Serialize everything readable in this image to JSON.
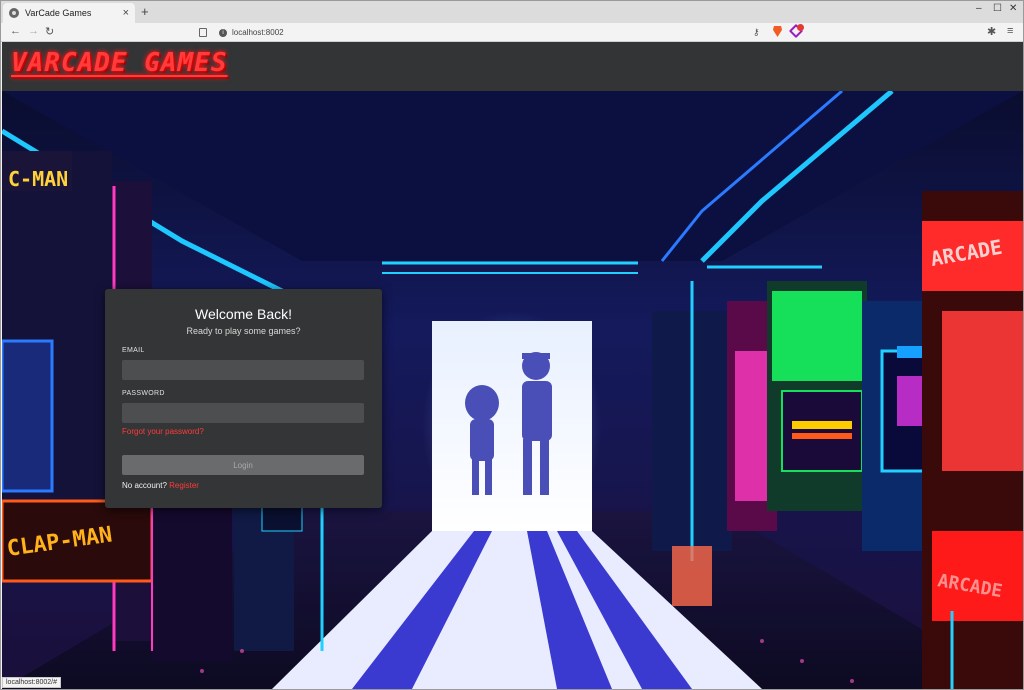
{
  "browser": {
    "tab_title": "VarCade Games",
    "tab_close": "×",
    "new_tab": "+",
    "url": "localhost:8002",
    "status_url": "localhost:8002/#",
    "window_controls": [
      "–",
      "☐",
      "✕"
    ],
    "nav": {
      "back": "←",
      "forward": "→",
      "reload": "↻",
      "key": "⚷",
      "extensions": "✱",
      "menu": "≡"
    }
  },
  "site": {
    "logo": "VarCade Games",
    "accent_color": "#ff3b3b"
  },
  "login": {
    "title": "Welcome Back!",
    "subtitle": "Ready to play some games?",
    "email_label": "EMAIL",
    "email_value": "",
    "password_label": "PASSWORD",
    "password_value": "",
    "forgot_link": "Forgot your password?",
    "submit_label": "Login",
    "no_account_text": "No account?",
    "register_link": "Register"
  }
}
